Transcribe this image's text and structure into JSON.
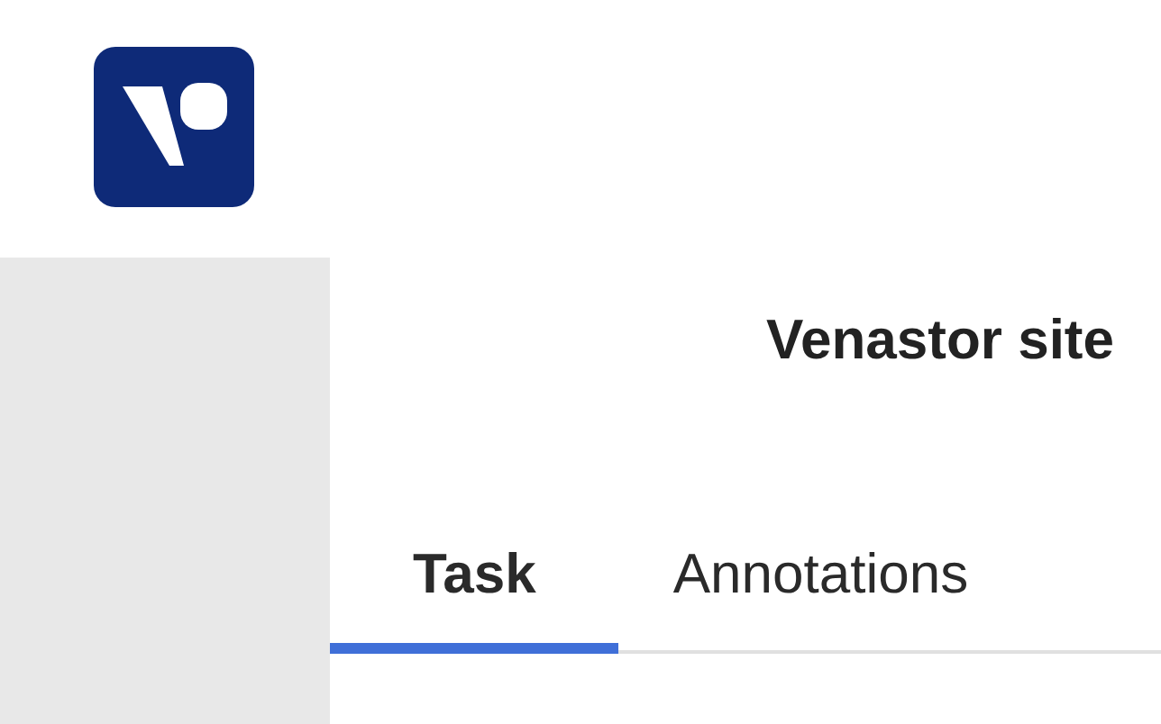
{
  "site": {
    "title": "Venastor site"
  },
  "tabs": [
    {
      "label": "Task",
      "selected": true
    },
    {
      "label": "Annotations",
      "selected": false
    }
  ]
}
